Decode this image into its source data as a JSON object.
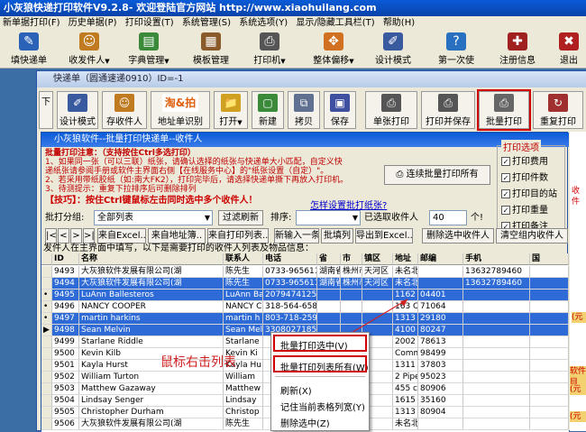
{
  "main": {
    "title": "小灰狼快递打印软件V9.2.8- 欢迎登陆官方网站 http://www.xiaohuilang.com",
    "menu": [
      "新单据打印(F)",
      "历史单据(P)",
      "打印设置(T)",
      "系统管理(S)",
      "系统选项(Y)",
      "显示/隐藏工具栏(T)",
      "帮助(H)"
    ],
    "toolbar": [
      {
        "label": "填快递单",
        "icon": "form-icon",
        "color": "#2a62b8"
      },
      {
        "label": "收发件人",
        "icon": "contacts-icon",
        "color": "#c07a20"
      },
      {
        "label": "字典管理",
        "icon": "dictionary-icon",
        "color": "#3a8a3a"
      },
      {
        "label": "模板管理",
        "icon": "template-icon",
        "color": "#8a5a2a"
      },
      {
        "label": "打印机",
        "icon": "printer-icon",
        "color": "#555"
      },
      {
        "label": "整体偏移",
        "icon": "move-icon",
        "color": "#d07020"
      },
      {
        "label": "设计模式",
        "icon": "design-icon",
        "color": "#3a5aa0"
      },
      {
        "label": "第一次使",
        "icon": "guide-icon",
        "color": "#2a70c0"
      },
      {
        "label": "注册信息",
        "icon": "register-icon",
        "color": "#a02020"
      },
      {
        "label": "退出",
        "icon": "exit-icon",
        "color": "#b02020"
      }
    ],
    "arrows": [
      "▼",
      "▼",
      "▼",
      "▼",
      "▼"
    ]
  },
  "w1": {
    "title": "快递单（圆通速递0910）ID=-1",
    "tabs": [
      "下"
    ],
    "toolbar": [
      {
        "label": "设计模式",
        "icon": "design-icon",
        "color": "#3a5aa0"
      },
      {
        "label": "存收件人",
        "icon": "save-contact-icon",
        "color": "#c07a20"
      },
      {
        "label": "地址单识别",
        "icon": "taobao-icon",
        "color": "#e06010",
        "logo": "淘&拍"
      },
      {
        "label": "打开",
        "icon": "open-folder-icon",
        "color": "#d0a020"
      },
      {
        "label": "新建",
        "icon": "new-file-icon",
        "color": "#3a8a3a"
      },
      {
        "label": "拷贝",
        "icon": "copy-icon",
        "color": "#607090"
      },
      {
        "label": "保存",
        "icon": "save-icon",
        "color": "#4050a0"
      },
      {
        "label": "单张打印",
        "icon": "print-icon",
        "color": "#555"
      },
      {
        "label": "打印并保存",
        "icon": "print-save-icon",
        "color": "#555"
      },
      {
        "label": "批量打印",
        "icon": "batch-print-icon",
        "color": "#666"
      },
      {
        "label": "重复打印",
        "icon": "reprint-icon",
        "color": "#a03030"
      }
    ]
  },
  "w2": {
    "title": "小灰狼软件--批量打印快递单--收件人",
    "info": [
      "批量打印注意：（支持按住Ctrl多选打印）",
      "1、如果同一张（可以三联）纸张，请确认选择的纸张与快递单大小匹配，自定义快",
      "递纸张请参阅手册或软件主界面右侧【在线服务中心】的\"纸张设置（自定）\"。",
      "2、若采用带纸胶纸（如:南大FK2），打印完毕后，请选择快递单撕下再放入打印机。",
      "3、待测提示：重复下拉排序后可删除排列"
    ],
    "tip": "【技巧】：按住Ctrl键鼠标左击同时选中多个收件人！",
    "connect_btn": "连续批量打印所有",
    "how_link": "怎样设置批打纸张?",
    "options": {
      "title": "打印选项",
      "items": [
        "打印费用",
        "打印件数",
        "打印目的站",
        "打印重量",
        "打印备注"
      ]
    },
    "group_label": "批打分组:",
    "group_value": "全部列表",
    "filter_btn": "过滤刷新",
    "sort_label": "排序:",
    "selected_label": "已选取收件人",
    "selected_count": "40",
    "selected_unit": "个!",
    "nav": [
      "|<",
      "<",
      ">",
      ">|"
    ],
    "buttons": [
      "来自Excel..",
      "来自地址簿..",
      "来自打印列表..",
      "新输入一条",
      "批填列",
      "导出到Excel..",
      "删除选中收件人",
      "清空组内收件人"
    ],
    "hint": "发件人在主界面中填写，以下是需要打印的收件人列表及物品信息：",
    "columns": [
      "ID",
      "名称",
      "联系人",
      "电话",
      "省",
      "市",
      "镇区",
      "地址",
      "邮编",
      "手机",
      "国"
    ],
    "rows": [
      {
        "m": "",
        "id": "9493",
        "name": "大灰狼软件发展有限公司(湖",
        "contact": "陈先生",
        "phone": "0733-96561186",
        "prov": "湖南省",
        "city": "株州市",
        "town": "天河区",
        "addr": "未名北",
        "zip": "",
        "mobile": "13632789460",
        "sel": false
      },
      {
        "m": "",
        "id": "9494",
        "name": "大灰狼软件发展有限公司(湖",
        "contact": "陈先生",
        "phone": "0733-96561186",
        "prov": "湖南省",
        "city": "株州市",
        "town": "天河区",
        "addr": "未名北",
        "zip": "",
        "mobile": "13632789460",
        "sel": true
      },
      {
        "m": "•",
        "id": "9495",
        "name": "LuAnn Ballesteros",
        "contact": "LuAnn Ba",
        "phone": "2079474125",
        "prov": "",
        "city": "",
        "town": "",
        "addr": "1162 H",
        "zip": "04401",
        "mobile": "",
        "sel": true
      },
      {
        "m": "•",
        "id": "9496",
        "name": "NANCY COOPER",
        "contact": "NANCY CO",
        "phone": "318-564-6582",
        "prov": "",
        "city": "",
        "town": "",
        "addr": "163 CR",
        "zip": "71064",
        "mobile": "",
        "sel": false
      },
      {
        "m": "•",
        "id": "9497",
        "name": "martin harkins",
        "contact": "martin h",
        "phone": "803-718-2592",
        "prov": "",
        "city": "",
        "town": "",
        "addr": "1313 b",
        "zip": "29180",
        "mobile": "",
        "sel": true
      },
      {
        "m": "▶",
        "id": "9498",
        "name": "Sean Melvin",
        "contact": "Sean Mel",
        "phone": "3308027185",
        "prov": "",
        "city": "",
        "town": "",
        "addr": "4100 E",
        "zip": "80247",
        "mobile": "",
        "sel": true
      },
      {
        "m": "",
        "id": "9499",
        "name": "Starlane Riddle",
        "contact": "Starlane",
        "phone": "",
        "prov": "",
        "city": "",
        "town": "",
        "addr": "2002 P",
        "zip": "78613",
        "mobile": "",
        "sel": false
      },
      {
        "m": "",
        "id": "9500",
        "name": "Kevin Kilb",
        "contact": "Kevin Ki",
        "phone": "",
        "prov": "",
        "city": "",
        "town": "",
        "addr": "Commo",
        "zip": "98499",
        "mobile": "",
        "sel": false
      },
      {
        "m": "",
        "id": "9501",
        "name": "Kayla Hurst",
        "contact": "Kayla Hu",
        "phone": "",
        "prov": "",
        "city": "",
        "town": "",
        "addr": "1311 Ke",
        "zip": "37803",
        "mobile": "",
        "sel": false
      },
      {
        "m": "",
        "id": "9502",
        "name": "William Turton",
        "contact": "William",
        "phone": "",
        "prov": "",
        "city": "",
        "town": "",
        "addr": "2 Pipe",
        "zip": "95023",
        "mobile": "",
        "sel": false
      },
      {
        "m": "",
        "id": "9503",
        "name": "Matthew Gazaway",
        "contact": "Matthew",
        "phone": "",
        "prov": "",
        "city": "",
        "town": "",
        "addr": "455 co",
        "zip": "80906",
        "mobile": "",
        "sel": false
      },
      {
        "m": "",
        "id": "9504",
        "name": "Lindsay Senger",
        "contact": "Lindsay",
        "phone": "",
        "prov": "",
        "city": "",
        "town": "",
        "addr": "1615 Ba",
        "zip": "35160",
        "mobile": "",
        "sel": false
      },
      {
        "m": "",
        "id": "9505",
        "name": "Christopher Durham",
        "contact": "Christop",
        "phone": "",
        "prov": "",
        "city": "",
        "town": "",
        "addr": "1313 N",
        "zip": "80904",
        "mobile": "",
        "sel": false
      },
      {
        "m": "",
        "id": "9506",
        "name": "大灰狼软件发展有限公司(湖",
        "contact": "陈先生",
        "phone": "",
        "prov": "",
        "city": "",
        "town": "",
        "addr": "未名北",
        "zip": "",
        "mobile": "",
        "sel": false
      }
    ]
  },
  "annotation": "鼠标右击列表",
  "context_menu": [
    "批量打印选中(V)",
    "批量打印列表所有(W)",
    "刷新(X)",
    "记住当前表格列宽(Y)",
    "删除选中(Z)"
  ],
  "right_strip": [
    "收件",
    "(元",
    "软件目",
    "(元",
    "(元"
  ]
}
